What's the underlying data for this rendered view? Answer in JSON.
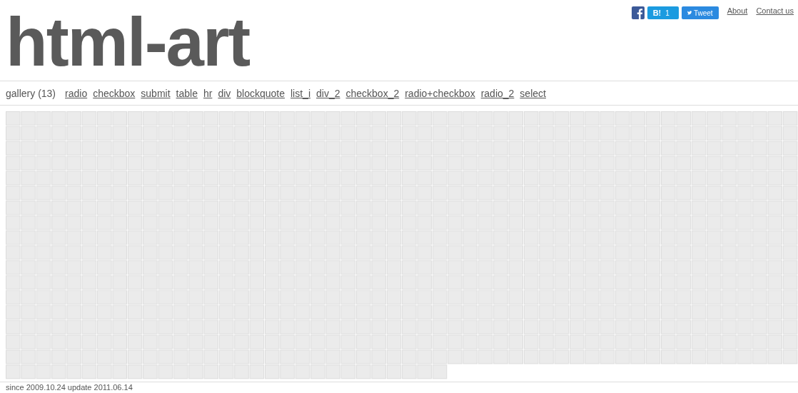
{
  "header": {
    "logo": "html-art",
    "share": {
      "hatena_label": "B!",
      "hatena_count": "1",
      "tweet_label": "Tweet"
    },
    "links": [
      "About",
      "Contact us"
    ]
  },
  "nav": {
    "label": "gallery (13)",
    "items": [
      "radio",
      "checkbox",
      "submit",
      "table",
      "hr",
      "div",
      "blockquote",
      "list_i",
      "div_2",
      "checkbox_2",
      "radio+checkbox",
      "radio_2",
      "select"
    ]
  },
  "footer": "since 2009.10.24 update 2011.06.14"
}
